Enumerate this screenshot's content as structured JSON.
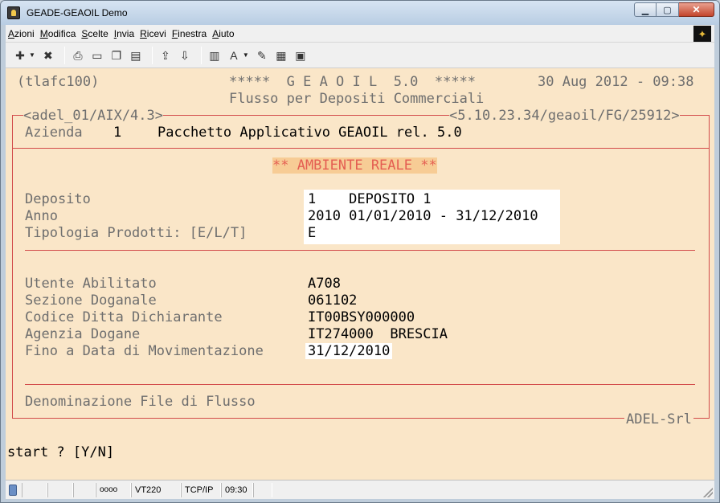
{
  "window": {
    "title": "GEADE-GEAOIL Demo",
    "btn_min": "▁",
    "btn_max": "▢",
    "btn_close": "✕"
  },
  "menu": {
    "items": [
      {
        "u": "A",
        "rest": "zioni"
      },
      {
        "u": "M",
        "rest": "odifica"
      },
      {
        "u": "S",
        "rest": "celte"
      },
      {
        "u": "I",
        "rest": "nvia"
      },
      {
        "u": "R",
        "rest": "icevi"
      },
      {
        "u": "F",
        "rest": "inestra"
      },
      {
        "u": "A",
        "rest": "iuto"
      }
    ],
    "logo_glyph": "✦"
  },
  "toolbar": {
    "icons": [
      "new-session-icon",
      "disconnect-icon",
      "print-icon",
      "open-folder-icon",
      "copy-icon",
      "paste-icon",
      "send-file-icon",
      "receive-file-icon",
      "book-icon",
      "font-icon",
      "edit-icon",
      "clipboard-icon",
      "screen-icon"
    ]
  },
  "terminal": {
    "header_left": "(tlafc100)",
    "header_center": "*****  G E A O I L  5.0  *****",
    "header_datetime": "30 Aug 2012 - 09:38",
    "header_subtitle": "Flusso per Depositi Commerciali",
    "frame_left_label": "<adel_01/AIX/4.3>",
    "frame_right_label": "<5.10.23.34/geaoil/FG/25912>",
    "azienda_label": "Azienda",
    "azienda_code": "1",
    "azienda_name": "Pacchetto Applicativo GEAOIL rel. 5.0",
    "env_badge": "** AMBIENTE REALE **",
    "labels": {
      "deposito": "Deposito",
      "anno": "Anno",
      "tipologia": "Tipologia Prodotti: [E/L/T]",
      "utente": "Utente Abilitato",
      "sezione": "Sezione Doganale",
      "codice": "Codice Ditta Dichiarante",
      "agenzia": "Agenzia Dogane",
      "fino": "Fino a Data di Movimentazione",
      "denominazione": "Denominazione File di Flusso"
    },
    "values": {
      "deposito": "1    DEPOSITO 1",
      "anno": "2010 01/01/2010 - 31/12/2010",
      "tipologia": "E",
      "utente": "A708",
      "sezione": "061102",
      "codice": "IT00BSY000000",
      "agenzia": "IT274000  BRESCIA",
      "fino": "31/12/2010"
    },
    "footer_brand": "ADEL-Srl",
    "prompt": "start ? [Y/N]"
  },
  "status": {
    "indicator": "oooo",
    "emulation": "VT220",
    "protocol": "TCP/IP",
    "time": "09:30"
  }
}
